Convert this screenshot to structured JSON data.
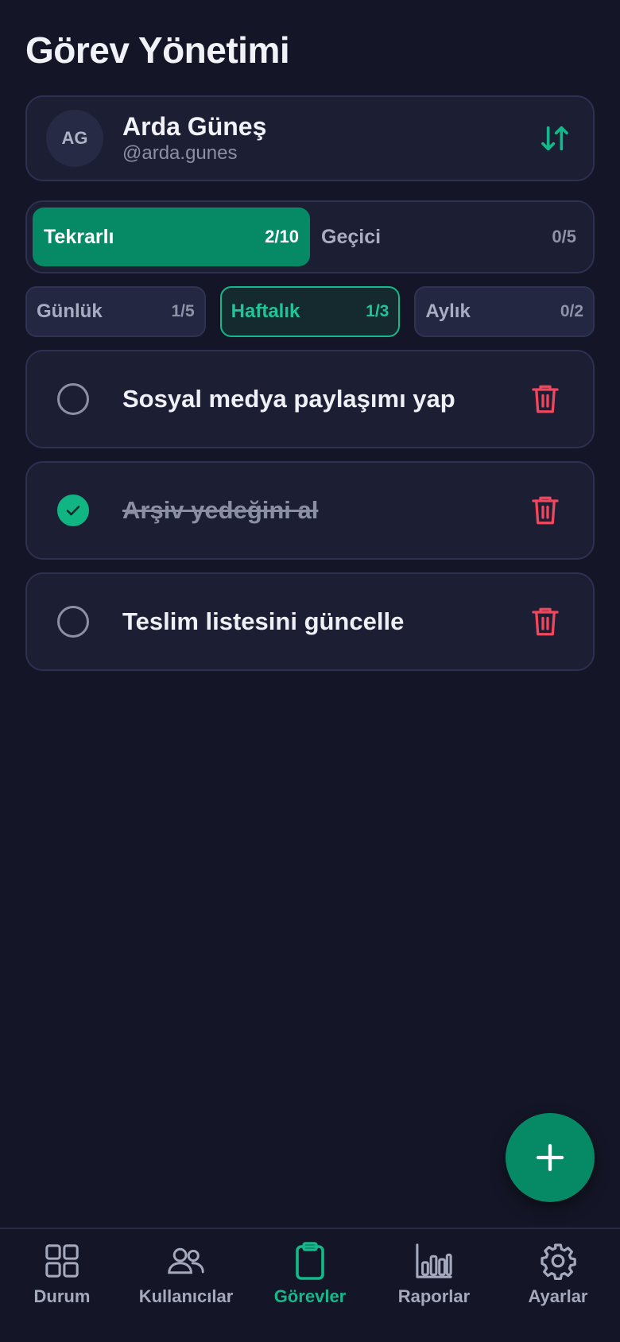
{
  "header": {
    "title": "Görev Yönetimi"
  },
  "user": {
    "initials": "AG",
    "name": "Arda Güneş",
    "handle": "@arda.gunes"
  },
  "type_tabs": [
    {
      "label": "Tekrarlı",
      "count": "2/10",
      "active": true
    },
    {
      "label": "Geçici",
      "count": "0/5",
      "active": false
    }
  ],
  "period_tabs": [
    {
      "label": "Günlük",
      "count": "1/5",
      "active": false
    },
    {
      "label": "Haftalık",
      "count": "1/3",
      "active": true
    },
    {
      "label": "Aylık",
      "count": "0/2",
      "active": false
    }
  ],
  "tasks": [
    {
      "label": "Sosyal medya paylaşımı yap",
      "done": false
    },
    {
      "label": "Arşiv yedeğini al",
      "done": true
    },
    {
      "label": "Teslim listesini güncelle",
      "done": false
    }
  ],
  "nav": [
    {
      "label": "Durum",
      "icon": "grid-icon",
      "active": false
    },
    {
      "label": "Kullanıcılar",
      "icon": "users-icon",
      "active": false
    },
    {
      "label": "Görevler",
      "icon": "clipboard-icon",
      "active": true
    },
    {
      "label": "Raporlar",
      "icon": "bar-chart-icon",
      "active": false
    },
    {
      "label": "Ayarlar",
      "icon": "gear-icon",
      "active": false
    }
  ],
  "colors": {
    "background": "#141627",
    "card": "#1c1e33",
    "accent": "#068a66",
    "accent_bright": "#14b88a",
    "danger": "#f0475d"
  }
}
